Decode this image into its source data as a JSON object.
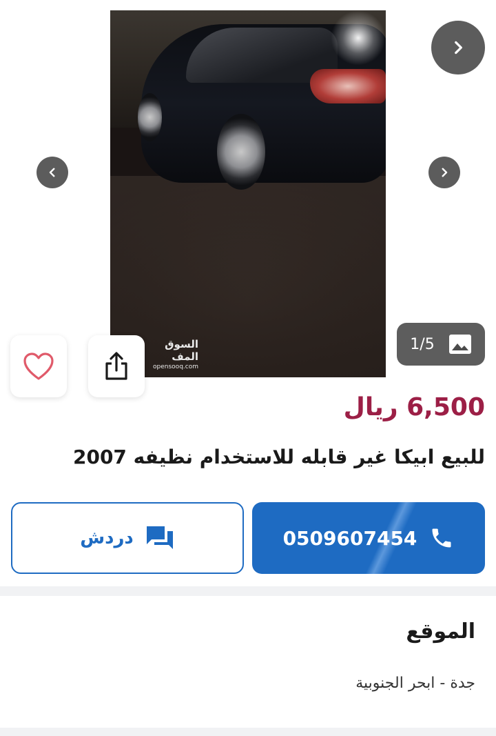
{
  "gallery": {
    "counter": "1/5",
    "watermark_ar": "السوق المف",
    "watermark_en": "opensooq.com"
  },
  "listing": {
    "price": "6,500 ريال",
    "title": "للبيع ابيكا غير قابله للاستخدام نظيفه 2007"
  },
  "actions": {
    "phone": "0509607454",
    "chat_label": "دردش"
  },
  "location": {
    "heading": "الموقع",
    "value": "جدة - ابحر الجنوبية"
  },
  "colors": {
    "price": "#9c1f46",
    "primary_blue": "#1e6bc2",
    "favorite_icon": "#e05a6a"
  },
  "icons": [
    "chevron-right-icon",
    "chevron-left-icon",
    "image-icon",
    "heart-icon",
    "share-icon",
    "phone-icon",
    "chat-icon"
  ]
}
